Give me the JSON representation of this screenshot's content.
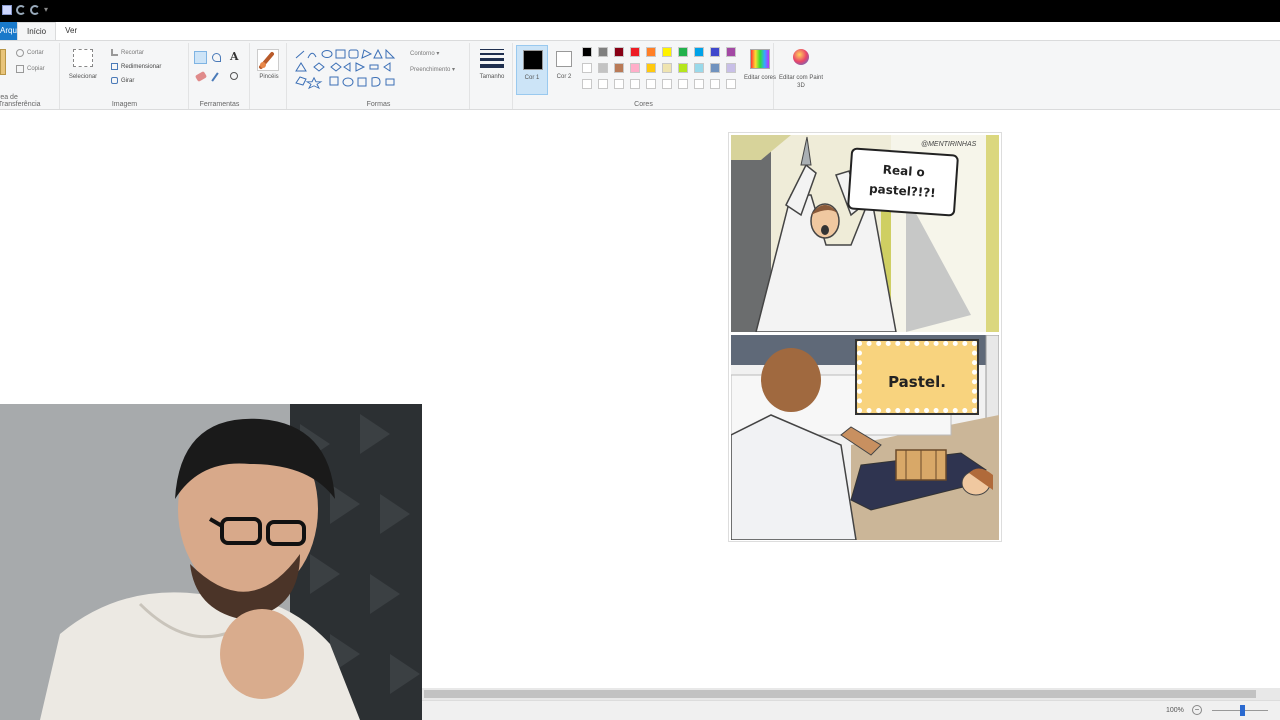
{
  "menu": {
    "file": "Arquivo",
    "home": "Início",
    "view": "Ver"
  },
  "ribbon": {
    "clipboard": {
      "label": "Área de Transferência",
      "label_visible": "rea de Transferência",
      "cut": "Cortar",
      "copy": "Copiar"
    },
    "image": {
      "label": "Imagem",
      "select": "Selecionar",
      "crop": "Recortar",
      "resize": "Redimensionar",
      "rotate": "Girar"
    },
    "tools": {
      "label": "Ferramentas"
    },
    "brushes": {
      "label": "Pincéis"
    },
    "shapes": {
      "label": "Formas",
      "outline": "Contorno",
      "fill": "Preenchimento"
    },
    "size": {
      "label": "Tamanho"
    },
    "colors": {
      "label": "Cores",
      "color1": "Cor 1",
      "color2": "Cor 2",
      "edit": "Editar cores",
      "paint3d": "Editar com Paint 3D",
      "color1_value": "#000000",
      "color2_value": "#ffffff",
      "palette": [
        "#000000",
        "#7f7f7f",
        "#880015",
        "#ed1c24",
        "#ff7f27",
        "#fff200",
        "#22b14c",
        "#00a2e8",
        "#3f48cc",
        "#a349a4",
        "#ffffff",
        "#c3c3c3",
        "#b97a57",
        "#ffaec9",
        "#ffc90e",
        "#efe4b0",
        "#b5e61d",
        "#99d9ea",
        "#7092be",
        "#c8bfe7"
      ]
    }
  },
  "comic": {
    "watermark": "@MENTIRINHAS",
    "bubble_top_line1": "Real o",
    "bubble_top_line2": "pastel?!?!",
    "bubble_bottom": "Pastel."
  },
  "status": {
    "zoom": "100%",
    "zoom_level": 0.54
  }
}
